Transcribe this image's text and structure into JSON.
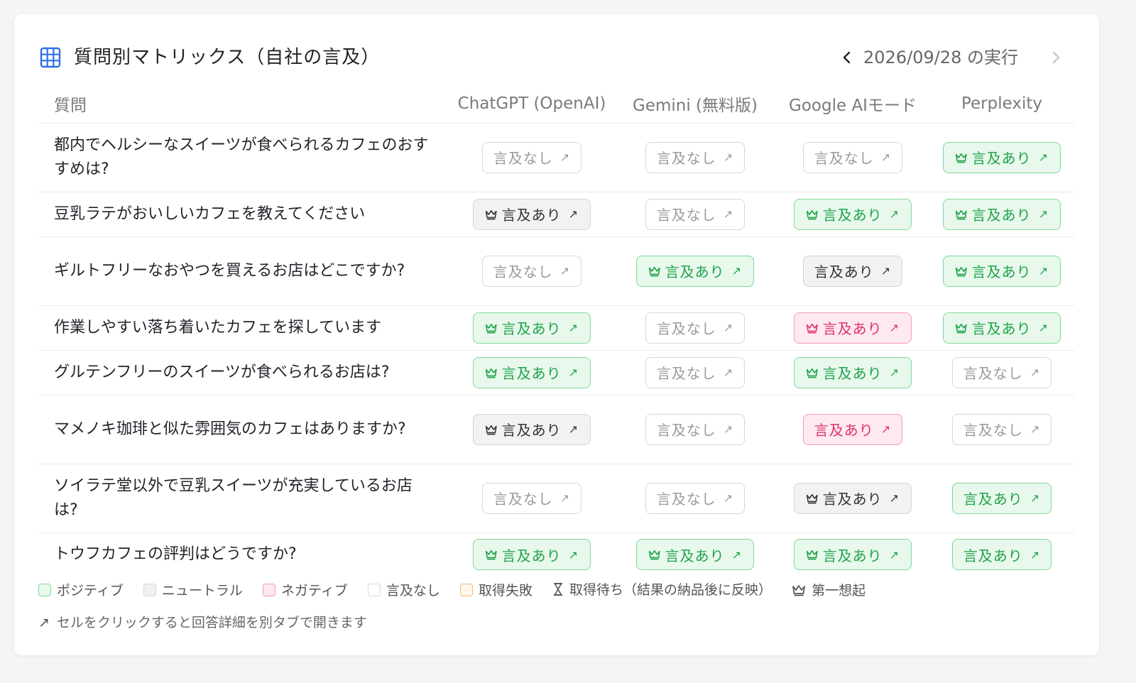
{
  "header": {
    "title": "質問別マトリックス（自社の言及）",
    "prev_icon": "chevron-left-icon",
    "date_label": "2026/09/28 の実行",
    "next_icon": "chevron-right-icon"
  },
  "columns": {
    "question": "質問",
    "engines": [
      "ChatGPT (OpenAI)",
      "Gemini (無料版)",
      "Google AIモード",
      "Perplexity"
    ]
  },
  "colors": {
    "positive": "#1fa34a",
    "negative": "#e0316a",
    "neutral": "#333333",
    "none": "#9a9a9a",
    "failed": "#f5b97a",
    "accent": "#2f6fe8"
  },
  "rows": [
    {
      "question": "都内でヘルシーなスイーツが食べられるカフェのおすすめは?",
      "cells": [
        {
          "label": "言及なし",
          "status": "none",
          "crown": false
        },
        {
          "label": "言及なし",
          "status": "none",
          "crown": false
        },
        {
          "label": "言及なし",
          "status": "none",
          "crown": false
        },
        {
          "label": "言及あり",
          "status": "positive",
          "crown": true
        }
      ]
    },
    {
      "question": "豆乳ラテがおいしいカフェを教えてください",
      "cells": [
        {
          "label": "言及あり",
          "status": "neutral",
          "crown": true
        },
        {
          "label": "言及なし",
          "status": "none",
          "crown": false
        },
        {
          "label": "言及あり",
          "status": "positive",
          "crown": true
        },
        {
          "label": "言及あり",
          "status": "positive",
          "crown": true
        }
      ]
    },
    {
      "question": "ギルトフリーなおやつを買えるお店はどこですか?",
      "cells": [
        {
          "label": "言及なし",
          "status": "none",
          "crown": false
        },
        {
          "label": "言及あり",
          "status": "positive",
          "crown": true
        },
        {
          "label": "言及あり",
          "status": "neutral",
          "crown": false
        },
        {
          "label": "言及あり",
          "status": "positive",
          "crown": true
        }
      ]
    },
    {
      "question": "作業しやすい落ち着いたカフェを探しています",
      "cells": [
        {
          "label": "言及あり",
          "status": "positive",
          "crown": true
        },
        {
          "label": "言及なし",
          "status": "none",
          "crown": false
        },
        {
          "label": "言及あり",
          "status": "negative",
          "crown": true
        },
        {
          "label": "言及あり",
          "status": "positive",
          "crown": true
        }
      ]
    },
    {
      "question": "グルテンフリーのスイーツが食べられるお店は?",
      "cells": [
        {
          "label": "言及あり",
          "status": "positive",
          "crown": true
        },
        {
          "label": "言及なし",
          "status": "none",
          "crown": false
        },
        {
          "label": "言及あり",
          "status": "positive",
          "crown": true
        },
        {
          "label": "言及なし",
          "status": "none",
          "crown": false
        }
      ]
    },
    {
      "question": "マメノキ珈琲と似た雰囲気のカフェはありますか?",
      "cells": [
        {
          "label": "言及あり",
          "status": "neutral",
          "crown": true
        },
        {
          "label": "言及なし",
          "status": "none",
          "crown": false
        },
        {
          "label": "言及あり",
          "status": "negative",
          "crown": false
        },
        {
          "label": "言及なし",
          "status": "none",
          "crown": false
        }
      ]
    },
    {
      "question": "ソイラテ堂以外で豆乳スイーツが充実しているお店は?",
      "cells": [
        {
          "label": "言及なし",
          "status": "none",
          "crown": false
        },
        {
          "label": "言及なし",
          "status": "none",
          "crown": false
        },
        {
          "label": "言及あり",
          "status": "neutral",
          "crown": true
        },
        {
          "label": "言及あり",
          "status": "positive",
          "crown": false
        }
      ]
    },
    {
      "question": "トウフカフェの評判はどうですか?",
      "cells": [
        {
          "label": "言及あり",
          "status": "positive",
          "crown": true
        },
        {
          "label": "言及あり",
          "status": "positive",
          "crown": true
        },
        {
          "label": "言及あり",
          "status": "positive",
          "crown": true
        },
        {
          "label": "言及あり",
          "status": "positive",
          "crown": false
        }
      ]
    }
  ],
  "legend": {
    "positive": "ポジティブ",
    "neutral": "ニュートラル",
    "negative": "ネガティブ",
    "none": "言及なし",
    "failed": "取得失敗",
    "pending": "取得待ち（結果の納品後に反映）",
    "first_recall": "第一想起"
  },
  "hint": {
    "icon": "arrow-up-right-icon",
    "text": "セルをクリックすると回答詳細を別タブで開きます"
  }
}
